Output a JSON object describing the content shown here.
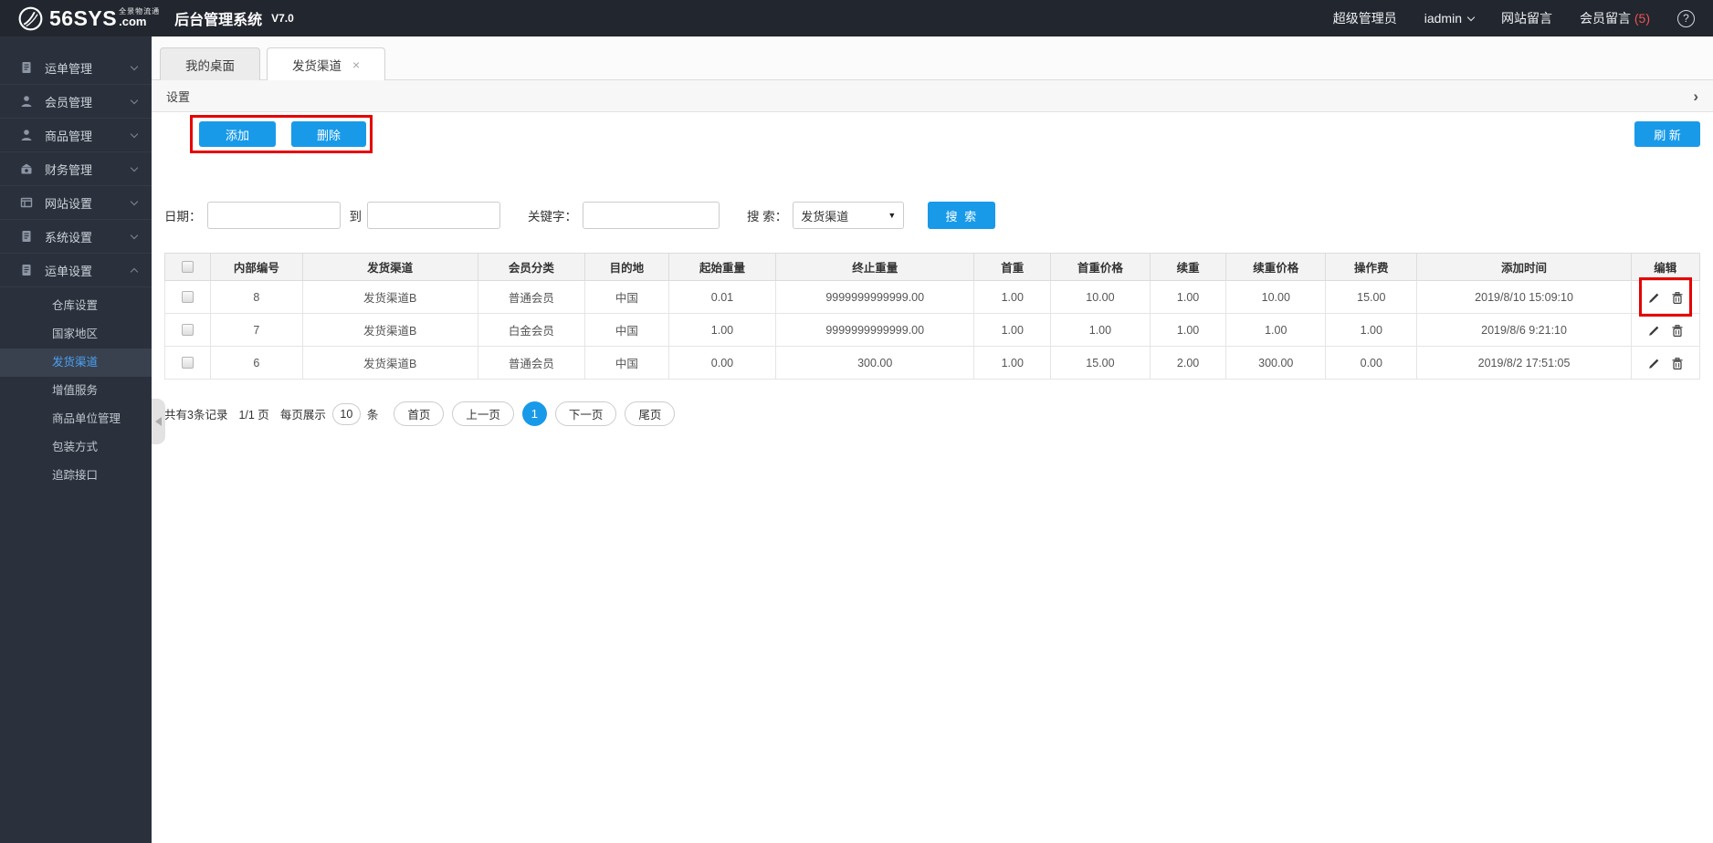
{
  "topbar": {
    "brand_main": "56SYS",
    "brand_sub": "全景物流通",
    "brand_domain": ".com",
    "title": "后台管理系统",
    "version": "V7.0",
    "role": "超级管理员",
    "username": "iadmin",
    "site_messages": "网站留言",
    "member_messages": "会员留言",
    "member_messages_count": "(5)"
  },
  "sidebar": {
    "items": [
      {
        "label": "运单管理",
        "icon": "doc-icon",
        "expanded": false
      },
      {
        "label": "会员管理",
        "icon": "user-icon",
        "expanded": false
      },
      {
        "label": "商品管理",
        "icon": "user-icon",
        "expanded": false
      },
      {
        "label": "财务管理",
        "icon": "money-icon",
        "expanded": false
      },
      {
        "label": "网站设置",
        "icon": "window-icon",
        "expanded": false
      },
      {
        "label": "系统设置",
        "icon": "doc-icon",
        "expanded": false
      },
      {
        "label": "运单设置",
        "icon": "doc-icon",
        "expanded": true,
        "children": [
          "仓库设置",
          "国家地区",
          "发货渠道",
          "增值服务",
          "商品单位管理",
          "包装方式",
          "追踪接口"
        ],
        "active_child": "发货渠道"
      }
    ]
  },
  "tabs": [
    {
      "label": "我的桌面",
      "closable": false,
      "active": false
    },
    {
      "label": "发货渠道",
      "closable": true,
      "active": true
    }
  ],
  "panel": {
    "title": "设置",
    "collapse_icon": "›"
  },
  "toolbar": {
    "add": "添加",
    "delete": "删除",
    "refresh": "刷 新"
  },
  "filters": {
    "date_label": "日期：",
    "to_label": "到",
    "keyword_label": "关键字：",
    "search_label": "搜 索：",
    "search_select_value": "发货渠道",
    "search_button": "搜 索"
  },
  "table": {
    "columns": [
      "内部编号",
      "发货渠道",
      "会员分类",
      "目的地",
      "起始重量",
      "终止重量",
      "首重",
      "首重价格",
      "续重",
      "续重价格",
      "操作费",
      "添加时间",
      "编辑"
    ],
    "rows": [
      {
        "cells": [
          "8",
          "发货渠道B",
          "普通会员",
          "中国",
          "0.01",
          "9999999999999.00",
          "1.00",
          "10.00",
          "1.00",
          "10.00",
          "15.00",
          "2019/8/10 15:09:10"
        ],
        "annotated": true
      },
      {
        "cells": [
          "7",
          "发货渠道B",
          "白金会员",
          "中国",
          "1.00",
          "9999999999999.00",
          "1.00",
          "1.00",
          "1.00",
          "1.00",
          "1.00",
          "2019/8/6 9:21:10"
        ],
        "annotated": false
      },
      {
        "cells": [
          "6",
          "发货渠道B",
          "普通会员",
          "中国",
          "0.00",
          "300.00",
          "1.00",
          "15.00",
          "2.00",
          "300.00",
          "0.00",
          "2019/8/2 17:51:05"
        ],
        "annotated": false
      }
    ]
  },
  "pagination": {
    "summary": "共有3条记录",
    "page_info": "1/1 页",
    "per_page_label": "每页展示",
    "per_page_value": "10",
    "unit": "条",
    "first": "首页",
    "prev": "上一页",
    "current": "1",
    "next": "下一页",
    "last": "尾页"
  },
  "colors": {
    "accent": "#189ae8",
    "annotation_red": "#e60000",
    "badge_red": "#f05353",
    "sidebar_bg": "#2b313c",
    "topbar_bg": "#22262e"
  }
}
